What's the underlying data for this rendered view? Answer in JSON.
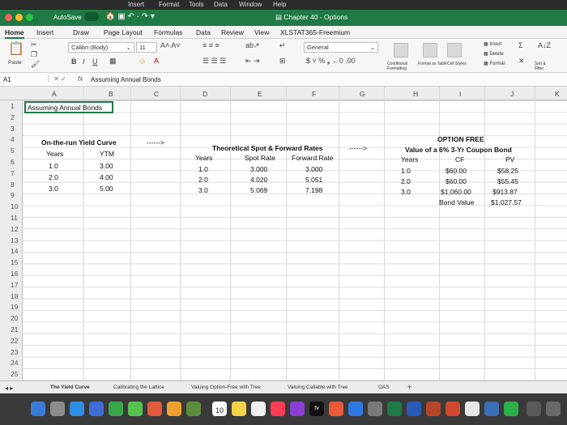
{
  "menubar": {
    "items": [
      "Insert",
      "Format",
      "Tools",
      "Data",
      "Window",
      "Help"
    ]
  },
  "titlebar": {
    "autosave": "AutoSave",
    "title": "Chapter 40 - Options"
  },
  "tabs": [
    "Home",
    "Insert",
    "Draw",
    "Page Layout",
    "Formulas",
    "Data",
    "Review",
    "View",
    "XLSTAT365-Freemium"
  ],
  "ribbon": {
    "paste": "Paste",
    "font_name": "Calibri (Body)",
    "font_size": "11",
    "number_format": "General",
    "conditional": "Conditional Formatting",
    "format_table": "Format as Table",
    "cell_styles": "Cell Styles",
    "insert": "Insert",
    "delete": "Delete",
    "format": "Format",
    "sort_filter": "Sort & Filter"
  },
  "formula_bar": {
    "name_box": "A1",
    "fx": "fx",
    "content": "Assuming Annual Bonds"
  },
  "columns": [
    "A",
    "B",
    "C",
    "D",
    "E",
    "F",
    "G",
    "H",
    "I",
    "J",
    "K"
  ],
  "rows": [
    "1",
    "2",
    "3",
    "4",
    "5",
    "6",
    "7",
    "8",
    "9",
    "10",
    "11",
    "12",
    "13",
    "14",
    "15",
    "16",
    "17",
    "18",
    "19",
    "20",
    "21",
    "22",
    "23",
    "24",
    "25"
  ],
  "cells": {
    "a1": "Assuming Annual Bonds",
    "yield_title": "On-the-run Yield Curve",
    "arrow1": "------>",
    "yield_years_hdr": "Years",
    "yield_ytm_hdr": "YTM",
    "yield_years": [
      "1.0",
      "2.0",
      "3.0"
    ],
    "yield_ytm": [
      "3.00",
      "4.00",
      "5.00"
    ],
    "theo_title": "Theoretical Spot & Forward Rates",
    "arrow2": "------>",
    "theo_years_hdr": "Years",
    "theo_spot_hdr": "Spot Rate",
    "theo_fwd_hdr": "Forward Rate",
    "theo_years": [
      "1.0",
      "2.0",
      "3.0"
    ],
    "theo_spot": [
      "3.000",
      "4.020",
      "5.069"
    ],
    "theo_fwd": [
      "3.000",
      "5.051",
      "7.198"
    ],
    "opt_title1": "OPTION FREE",
    "opt_title2": "Value of a 6% 3-Yr Coupon Bond",
    "opt_years_hdr": "Years",
    "opt_cf_hdr": "CF",
    "opt_pv_hdr": "PV",
    "opt_years": [
      "1.0",
      "2.0",
      "3.0"
    ],
    "opt_cf": [
      "$60.00",
      "$60.00",
      "$1,060.00"
    ],
    "opt_pv": [
      "$58.25",
      "$55.45",
      "$913.87"
    ],
    "bond_value_label": "Bond Value",
    "bond_value": "$1,027.57"
  },
  "sheet_tabs": [
    "The Yield Curve",
    "Calibrating the Lattice",
    "Valuing Option-Free with Tree",
    "Valuing Callable with Tree",
    "OAS",
    "+"
  ],
  "dock": {
    "calendar_day": "10",
    "tv_label": "tv"
  }
}
